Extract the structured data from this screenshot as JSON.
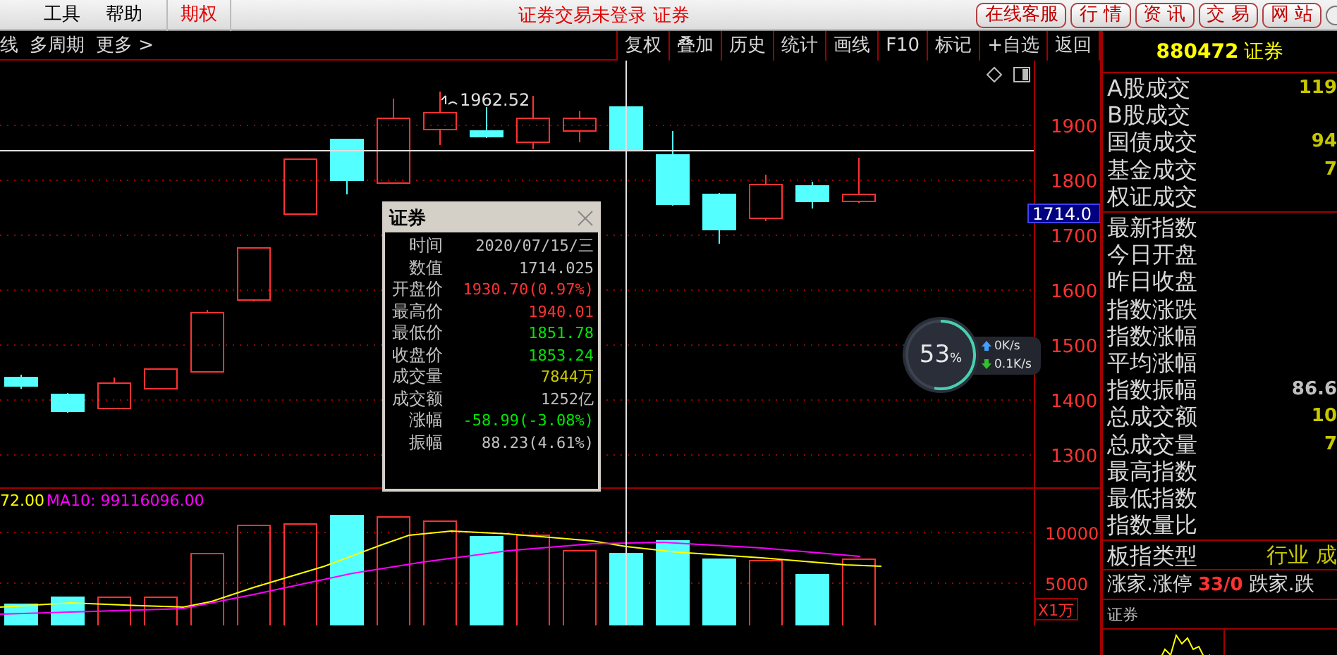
{
  "menu": {
    "items": [
      {
        "label": "工具",
        "selected": false
      },
      {
        "label": "帮助",
        "selected": false
      },
      {
        "label": "期权",
        "selected": true
      }
    ],
    "status": "证券交易未登录 证券",
    "buttons": [
      "在线客服",
      "行 情",
      "资 讯",
      "交 易",
      "网 站"
    ]
  },
  "toolbar": {
    "left": [
      "线",
      "多周期",
      "更多 >"
    ],
    "right": [
      "复权",
      "叠加",
      "历史",
      "统计",
      "画线",
      "F10",
      "标记",
      "+自选",
      "返回"
    ]
  },
  "price_chart": {
    "y_ticks": [
      "1900",
      "1800",
      "1700",
      "1600",
      "1500",
      "1400",
      "1300"
    ],
    "cursor_price": "1714.0",
    "peak_label": "1962.52"
  },
  "volume_chart": {
    "legend": [
      {
        "text": "72.00",
        "color": "#ffff00"
      },
      {
        "text": "MA10: 99116096.00",
        "color": "#ff00ff"
      }
    ],
    "y_ticks": [
      "10000",
      "5000"
    ],
    "unit": "X1万"
  },
  "tooltip": {
    "title": "证券",
    "rows": [
      {
        "label": "时间",
        "value": "2020/07/15/三",
        "color": "#c0c0c0"
      },
      {
        "label": "数值",
        "value": "1714.025",
        "color": "#c0c0c0"
      },
      {
        "label": "开盘价",
        "value": "1930.70(0.97%)",
        "color": "#ff3232"
      },
      {
        "label": "最高价",
        "value": "1940.01",
        "color": "#ff3232"
      },
      {
        "label": "最低价",
        "value": "1851.78",
        "color": "#00e600"
      },
      {
        "label": "收盘价",
        "value": "1853.24",
        "color": "#00e600"
      },
      {
        "label": "成交量",
        "value": "7844万",
        "color": "#c8c800"
      },
      {
        "label": "成交额",
        "value": "1252亿",
        "color": "#c0c0c0"
      },
      {
        "label": "涨幅",
        "value": "-58.99(-3.08%)",
        "color": "#00e600"
      },
      {
        "label": "振幅",
        "value": "88.23(4.61%)",
        "color": "#c0c0c0"
      }
    ]
  },
  "quote_panel": {
    "code": "880472",
    "name": "证券",
    "groups": [
      [
        {
          "label": "A股成交",
          "value": "119",
          "color": "#c8c800"
        },
        {
          "label": "B股成交"
        },
        {
          "label": "国债成交",
          "value": "94",
          "color": "#c8c800"
        },
        {
          "label": "基金成交",
          "value": "7",
          "color": "#c8c800"
        },
        {
          "label": "权证成交"
        }
      ],
      [
        {
          "label": "最新指数"
        },
        {
          "label": "今日开盘"
        },
        {
          "label": "昨日收盘"
        },
        {
          "label": "指数涨跌"
        },
        {
          "label": "指数涨幅"
        },
        {
          "label": "平均涨幅"
        },
        {
          "label": "指数振幅",
          "value": "86.6",
          "color": "#c0c0c0"
        },
        {
          "label": "总成交额",
          "value": "10",
          "color": "#c8c800"
        },
        {
          "label": "总成交量",
          "value": "7",
          "color": "#c8c800"
        },
        {
          "label": "最高指数"
        },
        {
          "label": "最低指数"
        },
        {
          "label": "指数量比"
        }
      ]
    ],
    "sector_type": {
      "label": "板指类型",
      "value": "行业 成"
    },
    "breadth": {
      "label": "涨家.涨停",
      "value": "33/0",
      "label_2": "跌家.跌"
    },
    "mini_chart_title": "证券"
  },
  "speed_widget": {
    "percent": "53",
    "unit": "%",
    "upload": "0K/s",
    "download": "0.1K/s",
    "level": 0.53
  }
}
